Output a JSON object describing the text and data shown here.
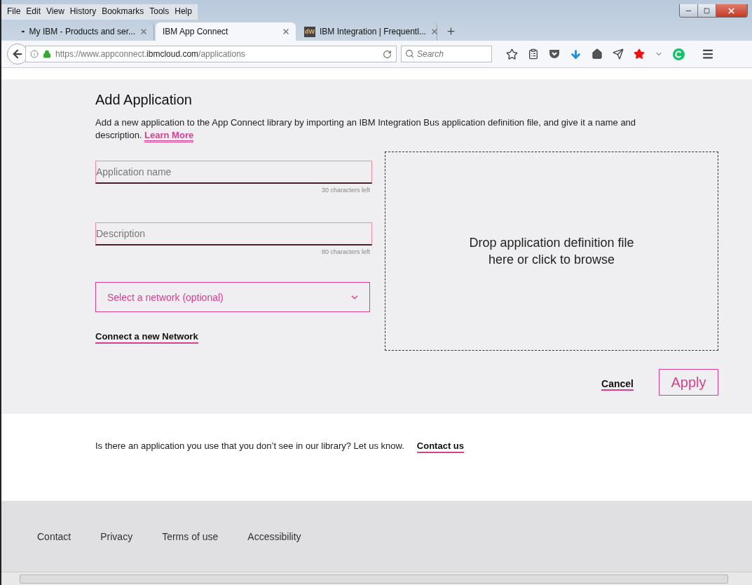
{
  "menu_bar": [
    "File",
    "Edit",
    "View",
    "History",
    "Bookmarks",
    "Tools",
    "Help"
  ],
  "tabs": [
    {
      "label": "My IBM - Products and ser...",
      "selected": false
    },
    {
      "label": "IBM App Connect",
      "selected": true
    },
    {
      "label": "IBM Integration | Frequentl...",
      "selected": false,
      "favicon_text": "dW"
    }
  ],
  "address_bar": {
    "prefix": "https://www.appconnect.",
    "domain": "ibmcloud.com",
    "path": "/applications"
  },
  "search": {
    "placeholder": "Search"
  },
  "form": {
    "title": "Add Application",
    "intro": "Add a new application to the App Connect library by importing an IBM Integration Bus application definition file, and give it a name and description.",
    "learn_more": "Learn More",
    "fields": [
      {
        "placeholder": "Application name",
        "counter": "30 characters left",
        "invalid": true
      },
      {
        "placeholder": "Description",
        "counter": "80 characters left",
        "invalid": true
      }
    ],
    "network_select": {
      "placeholder": "Select a network (optional)"
    },
    "connect_link": "Connect a new Network",
    "drop_zone": {
      "line_1": "Drop application definition file",
      "line_2": "here or click to browse"
    },
    "cancel": "Cancel",
    "apply": "Apply"
  },
  "feedback": {
    "text": "Is there an application you use that you don’t see in our library? Let us know.",
    "link": "Contact us"
  },
  "footer": [
    "Contact",
    "Privacy",
    "Terms of use",
    "Accessibility"
  ]
}
